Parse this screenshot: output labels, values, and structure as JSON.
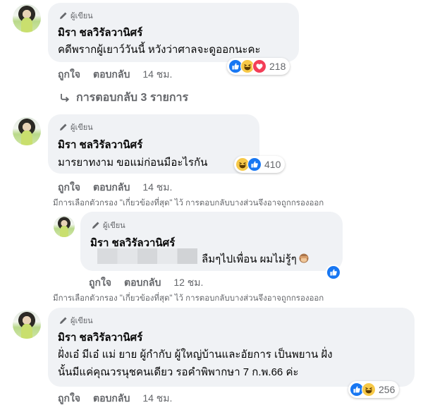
{
  "comments": [
    {
      "author_tag": "ผู้เขียน",
      "name": "มิรา ชลวิรัลวานิศร์",
      "text": "คดีพรากผู้เยาว์วันนี้ หวังว่าศาลจะดูออกนะคะ",
      "like": "ถูกใจ",
      "reply": "ตอบกลับ",
      "time": "14 ชม.",
      "reactions": {
        "icons": [
          "like-icon",
          "haha-icon",
          "love-icon"
        ],
        "count": "218"
      },
      "replies_link": "การตอบกลับ 3 รายการ"
    },
    {
      "author_tag": "ผู้เขียน",
      "name": "มิรา ชลวิรัลวานิศร์",
      "text": "มารยาทงาม ขอแม่ก่อนมือะไรกัน",
      "like": "ถูกใจ",
      "reply": "ตอบกลับ",
      "time": "14 ชม.",
      "reactions": {
        "icons": [
          "haha-icon",
          "like-icon"
        ],
        "count": "410"
      },
      "filter_note": "มีการเลือกตัวกรอง \"เกี่ยวข้องที่สุด\" ไว้ การตอบกลับบางส่วนจึงอาจถูกกรองออก"
    },
    {
      "author_tag": "ผู้เขียน",
      "name": "มิรา ชลวิรัลวานิศร์",
      "text": "ลืมๆไปเพื่อน ผมไม่รู้ๆ",
      "emoji": "see-no-evil-monkey-icon",
      "like": "ถูกใจ",
      "reply": "ตอบกลับ",
      "time": "12 ชม.",
      "reactions": {
        "icons": [
          "like-icon"
        ]
      },
      "filter_note": "มีการเลือกตัวกรอง \"เกี่ยวข้องที่สุด\" ไว้ การตอบกลับบางส่วนจึงอาจถูกกรองออก"
    },
    {
      "author_tag": "ผู้เขียน",
      "name": "มิรา ชลวิรัลวานิศร์",
      "text_line1": "ฝั่งเอ๋ มีเอ๋ แม่ ยาย ผู้กำกับ ผู้ใหญ่บ้านและอัยการ เป็นพยาน ฝั่ง",
      "text_line2": "นั้นมีแค่คุณวรนุชคนเดียว รอคำพิพากษา 7 ก.พ.66 ค่ะ",
      "like": "ถูกใจ",
      "reply": "ตอบกลับ",
      "time": "14 ชม.",
      "reactions": {
        "icons": [
          "like-icon",
          "haha-icon"
        ],
        "count": "256"
      }
    }
  ],
  "colors": {
    "bubble": "#f0f2f5",
    "meta_text": "#65676b",
    "like_blue": "#1877f2",
    "haha_yellow": "#f7c948",
    "love_red": "#f33e58"
  }
}
